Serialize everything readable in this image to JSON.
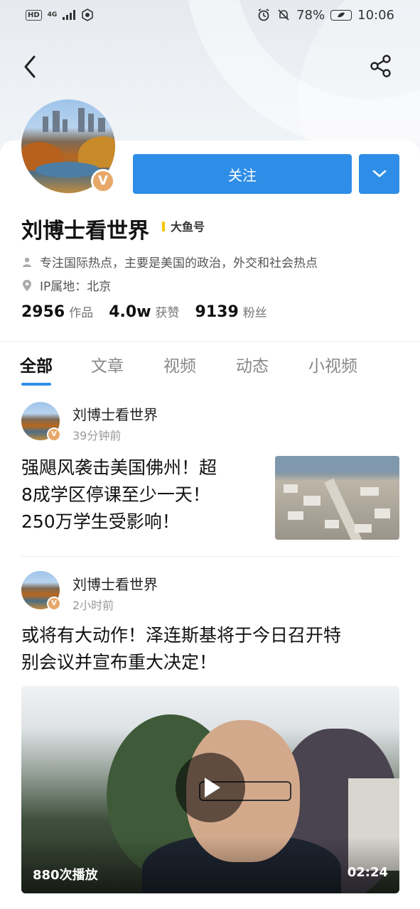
{
  "status_bar": {
    "hd": "HD",
    "network": "4G",
    "battery_percent": "78%",
    "time": "10:06",
    "icons": [
      "alarm-icon",
      "mute-icon",
      "battery-icon"
    ]
  },
  "nav": {
    "back_icon": "chevron-left-icon",
    "share_icon": "share-icon"
  },
  "profile": {
    "name": "刘博士看世界",
    "tag": "大鱼号",
    "follow_label": "关注",
    "more_icon": "chevron-down-icon",
    "verified_badge": "V",
    "bio": "专注国际热点，主要是美国的政治，外交和社会热点",
    "ip_location": "IP属地：北京",
    "stats": [
      {
        "value": "2956",
        "label": "作品"
      },
      {
        "value": "4.0w",
        "label": "获赞"
      },
      {
        "value": "9139",
        "label": "粉丝"
      }
    ]
  },
  "tabs": [
    {
      "label": "全部",
      "active": true
    },
    {
      "label": "文章",
      "active": false
    },
    {
      "label": "视频",
      "active": false
    },
    {
      "label": "动态",
      "active": false
    },
    {
      "label": "小视频",
      "active": false
    }
  ],
  "posts": [
    {
      "author": "刘博士看世界",
      "time": "39分钟前",
      "title_lines": [
        "强飓风袭击美国佛州！超",
        "8成学区停课至少一天！",
        "250万学生受影响！"
      ]
    },
    {
      "author": "刘博士看世界",
      "time": "2小时前",
      "title_lines": [
        "或将有大动作！泽连斯基将于今日召开特",
        "别会议并宣布重大决定！"
      ],
      "video": {
        "views": "880次播放",
        "duration": "02:24"
      }
    }
  ],
  "colors": {
    "accent": "#2e8de6",
    "badge": "#e8a869",
    "tag_bar": "#f5c400"
  }
}
